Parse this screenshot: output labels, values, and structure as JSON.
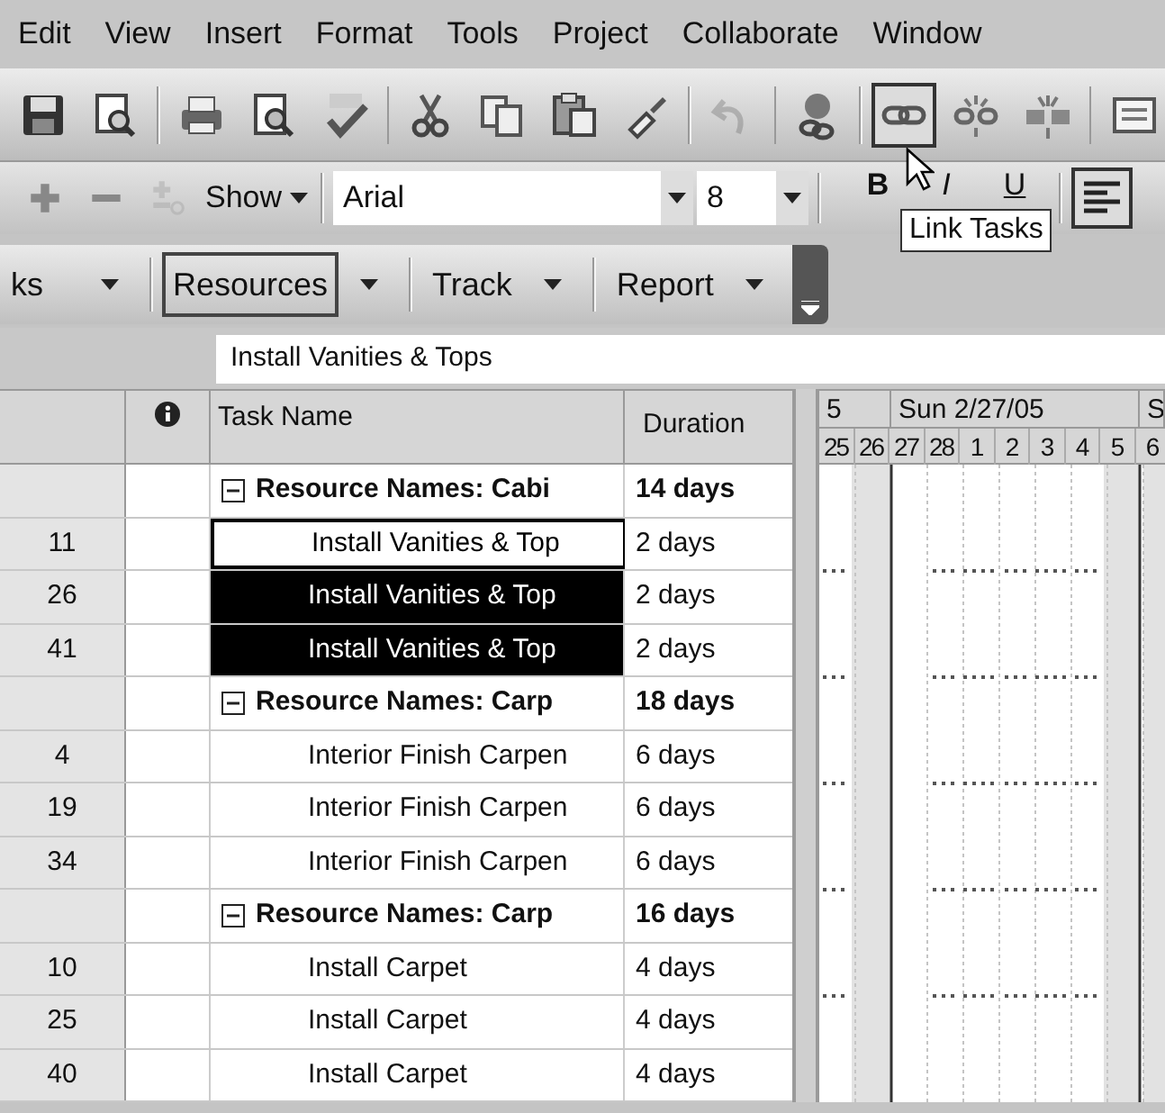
{
  "menu": [
    {
      "label": "Edit"
    },
    {
      "label": "View"
    },
    {
      "label": "Insert"
    },
    {
      "label": "Format"
    },
    {
      "label": "Tools"
    },
    {
      "label": "Project"
    },
    {
      "label": "Collaborate"
    },
    {
      "label": "Window"
    }
  ],
  "standard_toolbar": [
    [
      {
        "kind": "save",
        "disabled": false,
        "pressed": false
      },
      {
        "kind": "template",
        "disabled": false,
        "pressed": false
      }
    ],
    [
      {
        "kind": "print",
        "disabled": false,
        "pressed": false
      },
      {
        "kind": "preview",
        "disabled": false,
        "pressed": false
      },
      {
        "kind": "spelling",
        "disabled": false,
        "pressed": false
      }
    ],
    [
      {
        "kind": "cut",
        "disabled": false,
        "pressed": false
      },
      {
        "kind": "copy",
        "disabled": false,
        "pressed": false
      },
      {
        "kind": "paste",
        "disabled": false,
        "pressed": false
      },
      {
        "kind": "painter",
        "disabled": false,
        "pressed": false
      }
    ],
    [
      {
        "kind": "undo",
        "disabled": true,
        "pressed": false
      }
    ],
    [
      {
        "kind": "hyperlink",
        "disabled": false,
        "pressed": false
      }
    ],
    [
      {
        "kind": "link",
        "disabled": false,
        "pressed": true
      },
      {
        "kind": "unlink",
        "disabled": false,
        "pressed": false
      },
      {
        "kind": "split",
        "disabled": false,
        "pressed": false
      }
    ],
    [
      {
        "kind": "note",
        "disabled": false,
        "pressed": false
      }
    ]
  ],
  "formatting_toolbar": {
    "outline_buttons": [
      {
        "kind": "indent",
        "disabled": false
      },
      {
        "kind": "outdent",
        "disabled": false
      },
      {
        "kind": "subtasks",
        "disabled": true
      }
    ],
    "show": {
      "label": "Show"
    },
    "font": {
      "value": "Arial"
    },
    "size": {
      "value": "8"
    },
    "styles": [
      {
        "label": "B",
        "kind": "bold"
      },
      {
        "label": "I",
        "kind": "italic"
      },
      {
        "label": "U",
        "kind": "underline"
      }
    ],
    "align_left": {
      "pressed": true
    }
  },
  "tooltip": {
    "text": "Link Tasks"
  },
  "guide_toolbar": [
    {
      "label": "ks",
      "pressed": false
    },
    {
      "label": "Resources",
      "pressed": true
    },
    {
      "label": "Track",
      "pressed": false
    },
    {
      "label": "Report",
      "pressed": false
    }
  ],
  "entry_bar": {
    "value": "Install Vanities & Tops"
  },
  "table": {
    "columns": [
      "Task Name",
      "Duration"
    ],
    "rows": [
      {
        "kind": "summary",
        "expanded": true,
        "name": "Resource Names: Cabi",
        "duration": "14 days",
        "selected": false,
        "active": false
      },
      {
        "kind": "task",
        "id": "11",
        "name": "Install Vanities & Top",
        "duration": "2 days",
        "selected": true,
        "active": true
      },
      {
        "kind": "task",
        "id": "26",
        "name": "Install Vanities & Top",
        "duration": "2 days",
        "selected": true,
        "active": false
      },
      {
        "kind": "task",
        "id": "41",
        "name": "Install Vanities & Top",
        "duration": "2 days",
        "selected": true,
        "active": false
      },
      {
        "kind": "summary",
        "expanded": true,
        "name": "Resource Names: Carp",
        "duration": "18 days",
        "selected": false,
        "active": false
      },
      {
        "kind": "task",
        "id": "4",
        "name": "Interior Finish Carpen",
        "duration": "6 days",
        "selected": false,
        "active": false
      },
      {
        "kind": "task",
        "id": "19",
        "name": "Interior Finish Carpen",
        "duration": "6 days",
        "selected": false,
        "active": false
      },
      {
        "kind": "task",
        "id": "34",
        "name": "Interior Finish Carpen",
        "duration": "6 days",
        "selected": false,
        "active": false
      },
      {
        "kind": "summary",
        "expanded": true,
        "name": "Resource Names: Carp",
        "duration": "16 days",
        "selected": false,
        "active": false
      },
      {
        "kind": "task",
        "id": "10",
        "name": "Install Carpet",
        "duration": "4 days",
        "selected": false,
        "active": false
      },
      {
        "kind": "task",
        "id": "25",
        "name": "Install Carpet",
        "duration": "4 days",
        "selected": false,
        "active": false
      },
      {
        "kind": "task",
        "id": "40",
        "name": "Install Carpet",
        "duration": "4 days",
        "selected": false,
        "active": false
      }
    ]
  },
  "timescale": {
    "major": [
      "5",
      "Sun 2/27/05",
      "S"
    ],
    "minor": [
      "25",
      "26",
      "27",
      "28",
      "1",
      "2",
      "3",
      "4",
      "5",
      "6"
    ]
  }
}
